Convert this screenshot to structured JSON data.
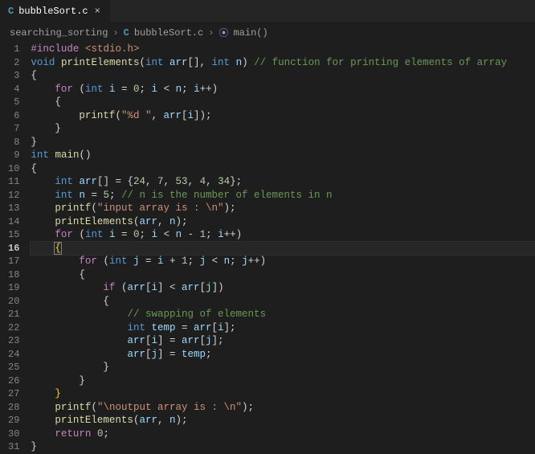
{
  "tab": {
    "icon_label": "C",
    "filename": "bubbleSort.c",
    "close_glyph": "×"
  },
  "breadcrumb": {
    "folder": "searching_sorting",
    "chev": "›",
    "file_icon": "C",
    "file": "bubbleSort.c",
    "sym_icon": "⦿",
    "symbol": "main()"
  },
  "active_line": 16,
  "lines": [
    {
      "n": 1,
      "tokens": [
        [
          "pp",
          "#include"
        ],
        [
          "pun",
          " "
        ],
        [
          "str",
          "<stdio.h>"
        ]
      ]
    },
    {
      "n": 2,
      "tokens": [
        [
          "kw",
          "void"
        ],
        [
          "pun",
          " "
        ],
        [
          "fn",
          "printElements"
        ],
        [
          "pun",
          "("
        ],
        [
          "kw",
          "int"
        ],
        [
          "pun",
          " "
        ],
        [
          "var",
          "arr"
        ],
        [
          "pun",
          "[], "
        ],
        [
          "kw",
          "int"
        ],
        [
          "pun",
          " "
        ],
        [
          "var",
          "n"
        ],
        [
          "pun",
          ") "
        ],
        [
          "cmt",
          "// function for printing elements of array"
        ]
      ]
    },
    {
      "n": 3,
      "tokens": [
        [
          "pun",
          "{"
        ]
      ]
    },
    {
      "n": 4,
      "tokens": [
        [
          "pun",
          "    "
        ],
        [
          "pp",
          "for"
        ],
        [
          "pun",
          " ("
        ],
        [
          "kw",
          "int"
        ],
        [
          "pun",
          " "
        ],
        [
          "var",
          "i"
        ],
        [
          "pun",
          " = "
        ],
        [
          "num",
          "0"
        ],
        [
          "pun",
          "; "
        ],
        [
          "var",
          "i"
        ],
        [
          "pun",
          " < "
        ],
        [
          "var",
          "n"
        ],
        [
          "pun",
          "; "
        ],
        [
          "var",
          "i"
        ],
        [
          "pun",
          "++)"
        ]
      ]
    },
    {
      "n": 5,
      "tokens": [
        [
          "pun",
          "    {"
        ]
      ]
    },
    {
      "n": 6,
      "tokens": [
        [
          "pun",
          "        "
        ],
        [
          "fn",
          "printf"
        ],
        [
          "pun",
          "("
        ],
        [
          "str",
          "\"%d \""
        ],
        [
          "pun",
          ", "
        ],
        [
          "var",
          "arr"
        ],
        [
          "pun",
          "["
        ],
        [
          "var",
          "i"
        ],
        [
          "pun",
          "]);"
        ]
      ]
    },
    {
      "n": 7,
      "tokens": [
        [
          "pun",
          "    }"
        ]
      ]
    },
    {
      "n": 8,
      "tokens": [
        [
          "pun",
          "}"
        ]
      ]
    },
    {
      "n": 9,
      "tokens": [
        [
          "kw",
          "int"
        ],
        [
          "pun",
          " "
        ],
        [
          "fn",
          "main"
        ],
        [
          "pun",
          "()"
        ]
      ]
    },
    {
      "n": 10,
      "tokens": [
        [
          "pun",
          "{"
        ]
      ]
    },
    {
      "n": 11,
      "tokens": [
        [
          "pun",
          "    "
        ],
        [
          "kw",
          "int"
        ],
        [
          "pun",
          " "
        ],
        [
          "var",
          "arr"
        ],
        [
          "pun",
          "[] = {"
        ],
        [
          "num",
          "24"
        ],
        [
          "pun",
          ", "
        ],
        [
          "num",
          "7"
        ],
        [
          "pun",
          ", "
        ],
        [
          "num",
          "53"
        ],
        [
          "pun",
          ", "
        ],
        [
          "num",
          "4"
        ],
        [
          "pun",
          ", "
        ],
        [
          "num",
          "34"
        ],
        [
          "pun",
          "};"
        ]
      ]
    },
    {
      "n": 12,
      "tokens": [
        [
          "pun",
          "    "
        ],
        [
          "kw",
          "int"
        ],
        [
          "pun",
          " "
        ],
        [
          "var",
          "n"
        ],
        [
          "pun",
          " = "
        ],
        [
          "num",
          "5"
        ],
        [
          "pun",
          "; "
        ],
        [
          "cmt",
          "// n is the number of elements in n"
        ]
      ]
    },
    {
      "n": 13,
      "tokens": [
        [
          "pun",
          "    "
        ],
        [
          "fn",
          "printf"
        ],
        [
          "pun",
          "("
        ],
        [
          "str",
          "\"input array is : \\n\""
        ],
        [
          "pun",
          ");"
        ]
      ]
    },
    {
      "n": 14,
      "tokens": [
        [
          "pun",
          "    "
        ],
        [
          "fn",
          "printElements"
        ],
        [
          "pun",
          "("
        ],
        [
          "var",
          "arr"
        ],
        [
          "pun",
          ", "
        ],
        [
          "var",
          "n"
        ],
        [
          "pun",
          ");"
        ]
      ]
    },
    {
      "n": 15,
      "tokens": [
        [
          "pun",
          "    "
        ],
        [
          "pp",
          "for"
        ],
        [
          "pun",
          " ("
        ],
        [
          "kw",
          "int"
        ],
        [
          "pun",
          " "
        ],
        [
          "var",
          "i"
        ],
        [
          "pun",
          " = "
        ],
        [
          "num",
          "0"
        ],
        [
          "pun",
          "; "
        ],
        [
          "var",
          "i"
        ],
        [
          "pun",
          " < "
        ],
        [
          "var",
          "n"
        ],
        [
          "pun",
          " - "
        ],
        [
          "num",
          "1"
        ],
        [
          "pun",
          "; "
        ],
        [
          "var",
          "i"
        ],
        [
          "pun",
          "++)"
        ]
      ]
    },
    {
      "n": 16,
      "tokens": [
        [
          "pun",
          "    "
        ],
        [
          "brk matchbox",
          "{"
        ]
      ]
    },
    {
      "n": 17,
      "tokens": [
        [
          "pun",
          "        "
        ],
        [
          "pp",
          "for"
        ],
        [
          "pun",
          " ("
        ],
        [
          "kw",
          "int"
        ],
        [
          "pun",
          " "
        ],
        [
          "var",
          "j"
        ],
        [
          "pun",
          " = "
        ],
        [
          "var",
          "i"
        ],
        [
          "pun",
          " + "
        ],
        [
          "num",
          "1"
        ],
        [
          "pun",
          "; "
        ],
        [
          "var",
          "j"
        ],
        [
          "pun",
          " < "
        ],
        [
          "var",
          "n"
        ],
        [
          "pun",
          "; "
        ],
        [
          "var",
          "j"
        ],
        [
          "pun",
          "++)"
        ]
      ]
    },
    {
      "n": 18,
      "tokens": [
        [
          "pun",
          "        {"
        ]
      ]
    },
    {
      "n": 19,
      "tokens": [
        [
          "pun",
          "            "
        ],
        [
          "pp",
          "if"
        ],
        [
          "pun",
          " ("
        ],
        [
          "var",
          "arr"
        ],
        [
          "pun",
          "["
        ],
        [
          "var",
          "i"
        ],
        [
          "pun",
          "] < "
        ],
        [
          "var",
          "arr"
        ],
        [
          "pun",
          "["
        ],
        [
          "var",
          "j"
        ],
        [
          "pun",
          "])"
        ]
      ]
    },
    {
      "n": 20,
      "tokens": [
        [
          "pun",
          "            {"
        ]
      ]
    },
    {
      "n": 21,
      "tokens": [
        [
          "pun",
          "                "
        ],
        [
          "cmt",
          "// swapping of elements"
        ]
      ]
    },
    {
      "n": 22,
      "tokens": [
        [
          "pun",
          "                "
        ],
        [
          "kw",
          "int"
        ],
        [
          "pun",
          " "
        ],
        [
          "var",
          "temp"
        ],
        [
          "pun",
          " = "
        ],
        [
          "var",
          "arr"
        ],
        [
          "pun",
          "["
        ],
        [
          "var",
          "i"
        ],
        [
          "pun",
          "];"
        ]
      ]
    },
    {
      "n": 23,
      "tokens": [
        [
          "pun",
          "                "
        ],
        [
          "var",
          "arr"
        ],
        [
          "pun",
          "["
        ],
        [
          "var",
          "i"
        ],
        [
          "pun",
          "] = "
        ],
        [
          "var",
          "arr"
        ],
        [
          "pun",
          "["
        ],
        [
          "var",
          "j"
        ],
        [
          "pun",
          "];"
        ]
      ]
    },
    {
      "n": 24,
      "tokens": [
        [
          "pun",
          "                "
        ],
        [
          "var",
          "arr"
        ],
        [
          "pun",
          "["
        ],
        [
          "var",
          "j"
        ],
        [
          "pun",
          "] = "
        ],
        [
          "var",
          "temp"
        ],
        [
          "pun",
          ";"
        ]
      ]
    },
    {
      "n": 25,
      "tokens": [
        [
          "pun",
          "            }"
        ]
      ]
    },
    {
      "n": 26,
      "tokens": [
        [
          "pun",
          "        }"
        ]
      ]
    },
    {
      "n": 27,
      "tokens": [
        [
          "pun",
          "    "
        ],
        [
          "brk",
          "}"
        ]
      ]
    },
    {
      "n": 28,
      "tokens": [
        [
          "pun",
          "    "
        ],
        [
          "fn",
          "printf"
        ],
        [
          "pun",
          "("
        ],
        [
          "str",
          "\"\\noutput array is : \\n\""
        ],
        [
          "pun",
          ");"
        ]
      ]
    },
    {
      "n": 29,
      "tokens": [
        [
          "pun",
          "    "
        ],
        [
          "fn",
          "printElements"
        ],
        [
          "pun",
          "("
        ],
        [
          "var",
          "arr"
        ],
        [
          "pun",
          ", "
        ],
        [
          "var",
          "n"
        ],
        [
          "pun",
          ");"
        ]
      ]
    },
    {
      "n": 30,
      "tokens": [
        [
          "pun",
          "    "
        ],
        [
          "pp",
          "return"
        ],
        [
          "pun",
          " "
        ],
        [
          "num",
          "0"
        ],
        [
          "pun",
          ";"
        ]
      ]
    },
    {
      "n": 31,
      "tokens": [
        [
          "pun",
          "}"
        ]
      ]
    }
  ]
}
